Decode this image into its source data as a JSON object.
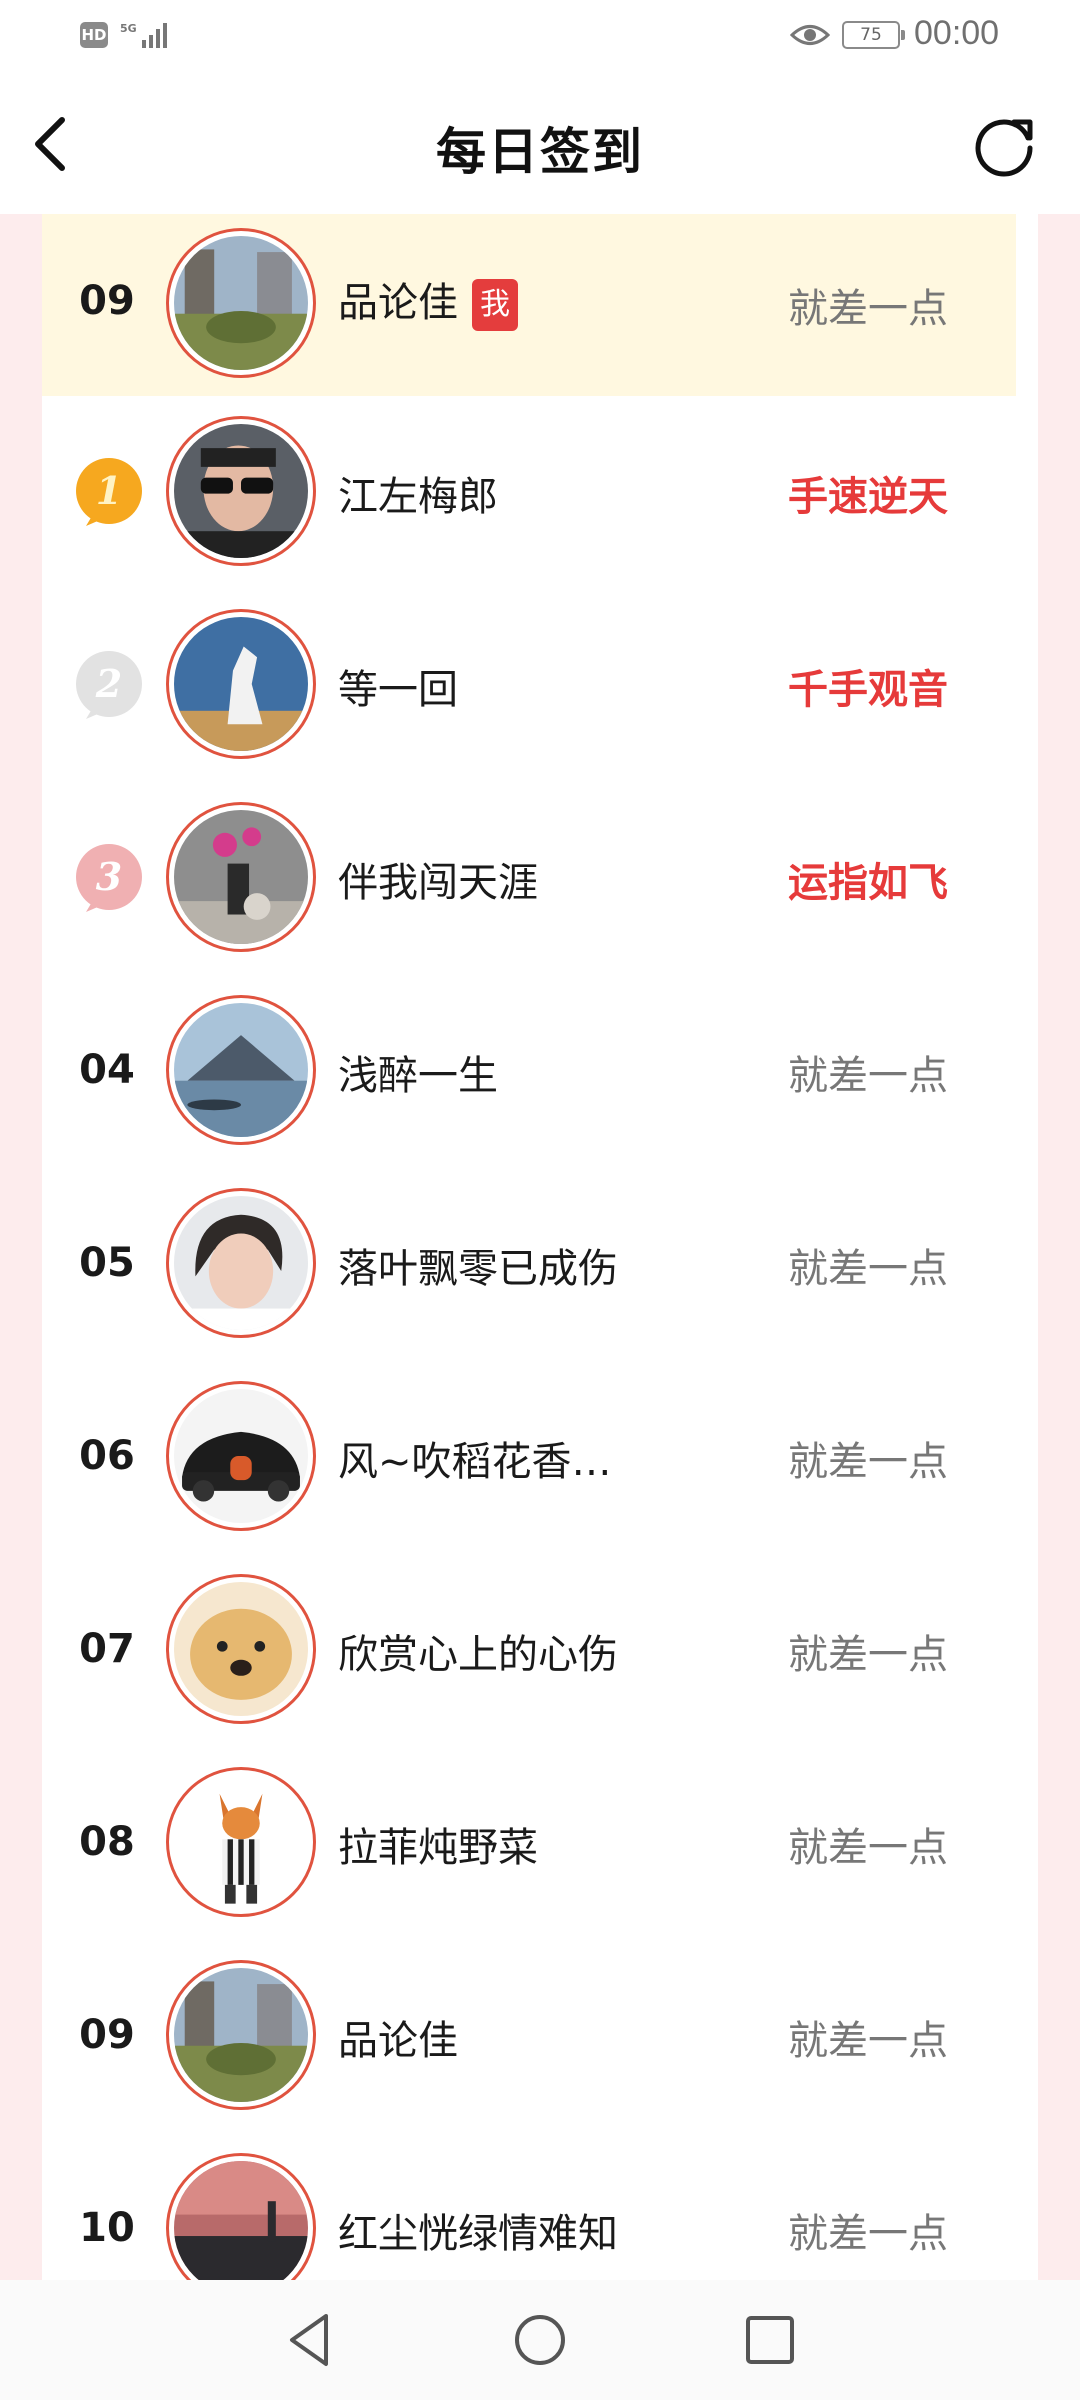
{
  "status_bar": {
    "hd": "HD",
    "net": "5G",
    "battery": "75",
    "time": "00:00"
  },
  "header": {
    "title": "每日签到",
    "back_icon": "chevron-left-icon",
    "refresh_icon": "refresh-icon"
  },
  "me_row": {
    "rank": "09",
    "name": "品论佳",
    "badge": "我",
    "status": "就差一点"
  },
  "rows": [
    {
      "rank": "1",
      "medal": "gold",
      "name": "江左梅郎",
      "status": "手速逆天",
      "hot": true
    },
    {
      "rank": "2",
      "medal": "silver",
      "name": "等一回",
      "status": "千手观音",
      "hot": true
    },
    {
      "rank": "3",
      "medal": "bronze",
      "name": "伴我闯天涯",
      "status": "运指如飞",
      "hot": true
    },
    {
      "rank": "04",
      "name": "浅醉一生",
      "status": "就差一点"
    },
    {
      "rank": "05",
      "name": "落叶飘零已成伤",
      "status": "就差一点"
    },
    {
      "rank": "06",
      "name": "风~吹稻花香…",
      "status": "就差一点"
    },
    {
      "rank": "07",
      "name": "欣赏心上的心伤",
      "status": "就差一点"
    },
    {
      "rank": "08",
      "name": "拉菲炖野菜",
      "status": "就差一点"
    },
    {
      "rank": "09",
      "name": "品论佳",
      "status": "就差一点"
    },
    {
      "rank": "10",
      "name": "红尘恍绿情难知",
      "status": "就差一点"
    }
  ],
  "colors": {
    "accent_red": "#e63a3a",
    "me_row_bg": "#fff8e0",
    "side_pink": "#fdeced",
    "avatar_ring": "#e0533f"
  }
}
